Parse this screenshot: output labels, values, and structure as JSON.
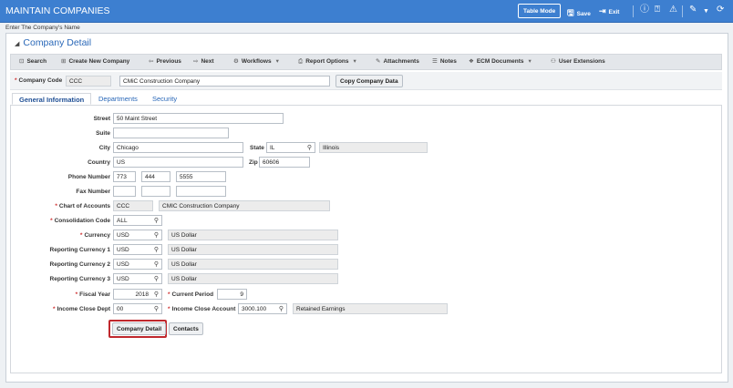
{
  "titlebar": {
    "title": "MAINTAIN COMPANIES",
    "table_mode": "Table Mode",
    "save": "Save",
    "exit": "Exit"
  },
  "hint": "Enter The Company's Name",
  "panel_title": "Company Detail",
  "toolbar": {
    "search": "Search",
    "create": "Create New Company",
    "previous": "Previous",
    "next": "Next",
    "workflows": "Workflows",
    "report_options": "Report Options",
    "attachments": "Attachments",
    "notes": "Notes",
    "ecm_documents": "ECM Documents",
    "user_extensions": "User Extensions"
  },
  "company": {
    "label": "Company Code",
    "code": "CCC",
    "name": "CMiC Construction Company",
    "copy_button": "Copy Company Data"
  },
  "tabs": [
    "General Information",
    "Departments",
    "Security"
  ],
  "labels": {
    "street": "Street",
    "suite": "Suite",
    "city": "City",
    "state": "State",
    "country": "Country",
    "zip": "Zip",
    "phone": "Phone Number",
    "fax": "Fax Number",
    "chart": "Chart of Accounts",
    "consolidation": "Consolidation Code",
    "currency": "Currency",
    "rc1": "Reporting Currency 1",
    "rc2": "Reporting Currency 2",
    "rc3": "Reporting Currency 3",
    "fiscal_year": "Fiscal Year",
    "current_period": "Current Period",
    "income_dept": "Income Close Dept",
    "income_account": "Income Close Account"
  },
  "values": {
    "street": "50 Maint Street",
    "suite": "",
    "city": "Chicago",
    "state": "IL",
    "state_name": "Illinois",
    "country": "US",
    "zip": "60606",
    "phone_area": "773",
    "phone_prefix": "444",
    "phone_line": "5555",
    "fax_area": "",
    "fax_prefix": "",
    "fax_line": "",
    "chart_code": "CCC",
    "chart_name": "CMIC Construction Company",
    "consolidation": "ALL",
    "currency": "USD",
    "currency_name": "US Dollar",
    "rc1": "USD",
    "rc1_name": "US Dollar",
    "rc2": "USD",
    "rc2_name": "US Dollar",
    "rc3": "USD",
    "rc3_name": "US Dollar",
    "fiscal_year": "2018",
    "current_period": "9",
    "income_dept": "00",
    "income_account": "3000.100",
    "income_account_name": "Retained Earnings"
  },
  "buttons": {
    "company_detail": "Company Detail",
    "contacts": "Contacts"
  },
  "colors": {
    "titlebar": "#3d7fd0",
    "accent": "#2a68b8",
    "highlight": "#c0282d"
  }
}
